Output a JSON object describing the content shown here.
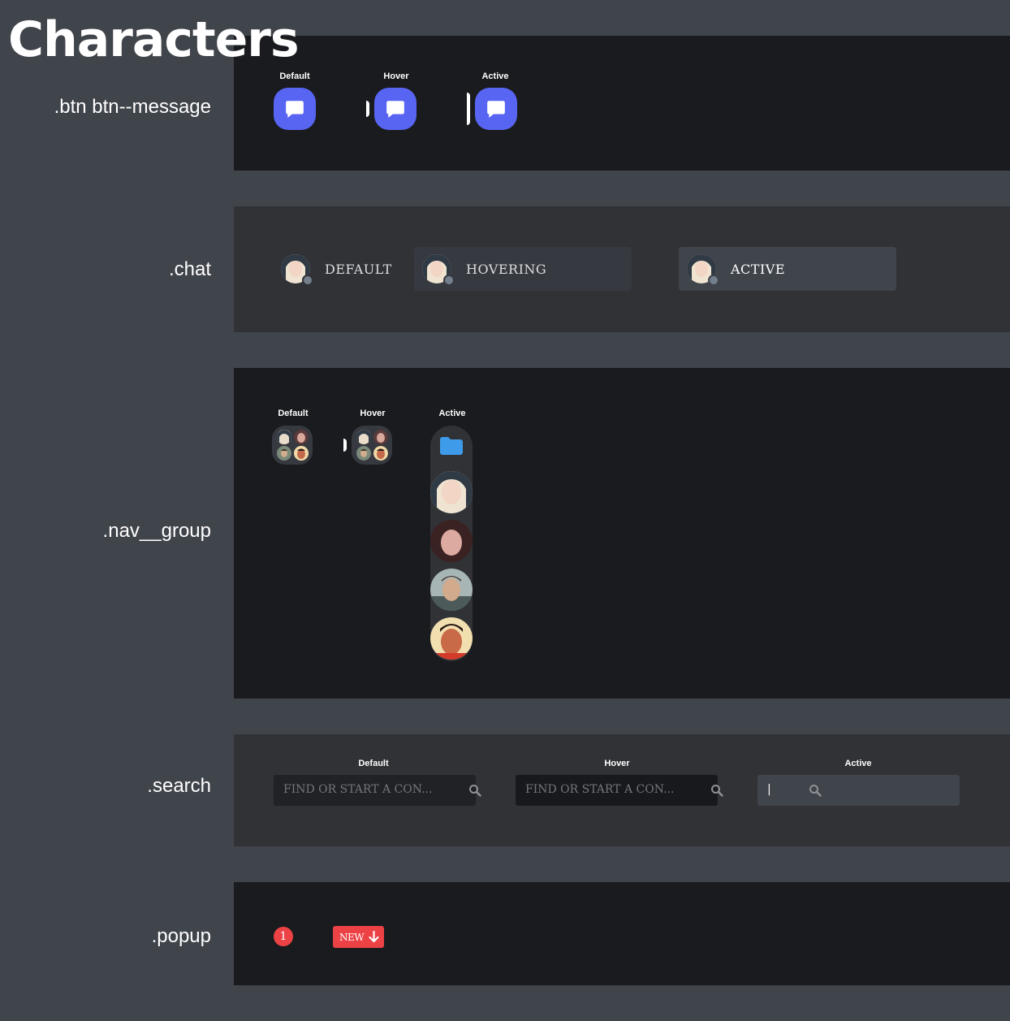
{
  "page": {
    "title": "Characters"
  },
  "rows": {
    "btn_message": "<i class=\"fa-solid fa-message\"></i>.btn btn--message",
    "chat": ".chat",
    "nav_group": ".nav__group",
    "search": ".search",
    "popup": ".popup"
  },
  "btn_message": {
    "states": [
      "Default",
      "Hover",
      "Active"
    ],
    "icon": "chat-bubble-icon",
    "color": "#5865f2"
  },
  "chat": {
    "items": [
      {
        "label": "DEFAULT",
        "state": "default"
      },
      {
        "label": "HOVERING",
        "state": "hover"
      },
      {
        "label": "ACTIVE",
        "state": "active"
      }
    ]
  },
  "nav_group": {
    "states": [
      "Default",
      "Hover",
      "Active"
    ],
    "folder_color": "#3d9be9"
  },
  "search": {
    "states": [
      "Default",
      "Hover",
      "Active"
    ],
    "placeholder": "FIND OR START A CON...",
    "active_value": "|"
  },
  "popup": {
    "badge_count": "1",
    "new_label": "NEW",
    "accent": "#ed4245"
  }
}
